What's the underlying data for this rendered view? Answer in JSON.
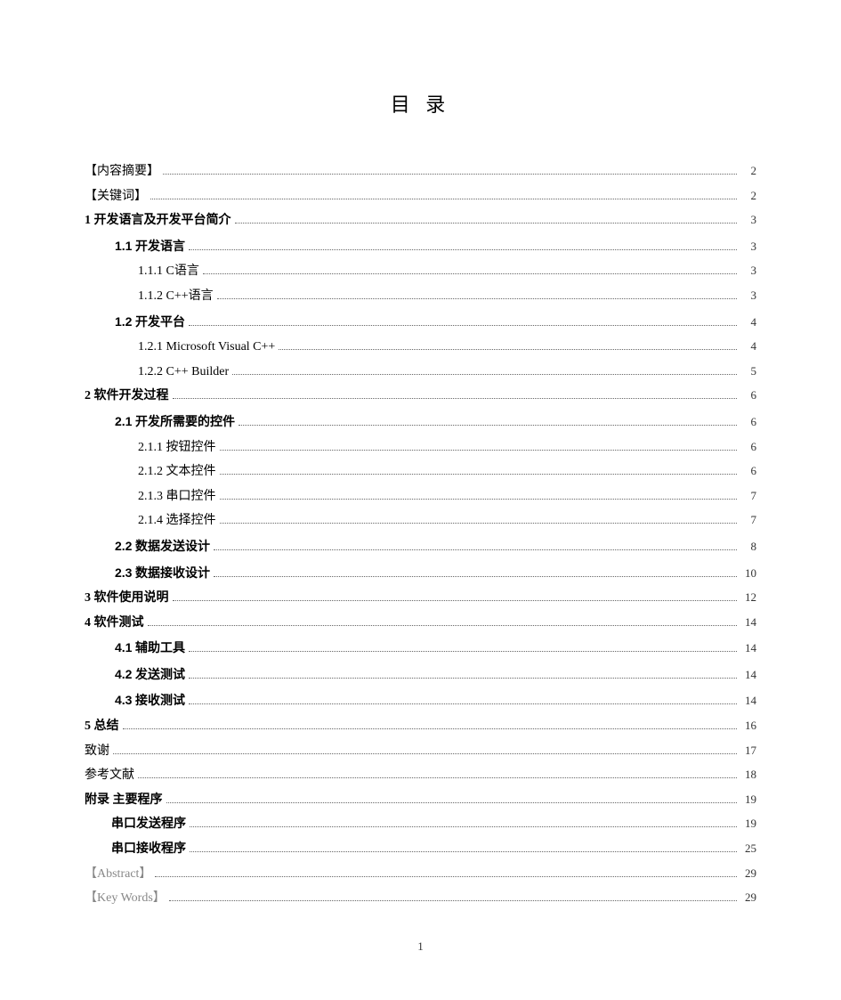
{
  "title": "目 录",
  "page_number": "1",
  "toc": [
    {
      "label": "【内容摘要】",
      "page": "2",
      "level": 0,
      "bold": false
    },
    {
      "label": "【关键词】",
      "page": "2",
      "level": 0,
      "bold": false
    },
    {
      "prefix": "1",
      "label": "开发语言及开发平台简介",
      "page": "3",
      "level": 0,
      "bold": true,
      "prefixClass": "num-serif bold"
    },
    {
      "prefix": "1.1",
      "label": "开发语言",
      "page": "3",
      "level": 1,
      "bold": true,
      "prefixClass": "num-sans"
    },
    {
      "prefix": "1.1.1",
      "label": "C语言",
      "page": "3",
      "level": 2,
      "bold": false,
      "prefixClass": "num-serif"
    },
    {
      "prefix": "1.1.2",
      "label": "C++语言",
      "page": "3",
      "level": 2,
      "bold": false,
      "prefixClass": "num-serif"
    },
    {
      "prefix": "1.2",
      "label": "开发平台",
      "page": "4",
      "level": 1,
      "bold": true,
      "prefixClass": "num-sans"
    },
    {
      "prefix": "1.2.1",
      "label": "Microsoft Visual C++",
      "page": "4",
      "level": 2,
      "bold": false,
      "prefixClass": "num-serif"
    },
    {
      "prefix": "1.2.2",
      "label": "C++ Builder",
      "page": "5",
      "level": 2,
      "bold": false,
      "prefixClass": "num-serif"
    },
    {
      "prefix": "2",
      "label": "软件开发过程",
      "page": "6",
      "level": 0,
      "bold": true,
      "prefixClass": "num-serif bold"
    },
    {
      "prefix": "2.1",
      "label": "开发所需要的控件",
      "page": "6",
      "level": 1,
      "bold": true,
      "prefixClass": "num-sans"
    },
    {
      "prefix": "2.1.1",
      "label": "按钮控件",
      "page": "6",
      "level": 2,
      "bold": false,
      "prefixClass": "num-serif"
    },
    {
      "prefix": "2.1.2",
      "label": "文本控件",
      "page": "6",
      "level": 2,
      "bold": false,
      "prefixClass": "num-serif"
    },
    {
      "prefix": "2.1.3",
      "label": "串口控件",
      "page": "7",
      "level": 2,
      "bold": false,
      "prefixClass": "num-serif"
    },
    {
      "prefix": "2.1.4",
      "label": "选择控件",
      "page": "7",
      "level": 2,
      "bold": false,
      "prefixClass": "num-serif"
    },
    {
      "prefix": "2.2",
      "label": "数据发送设计",
      "page": "8",
      "level": 1,
      "bold": true,
      "prefixClass": "num-sans"
    },
    {
      "prefix": "2.3",
      "label": "数据接收设计",
      "page": "10",
      "level": 1,
      "bold": true,
      "prefixClass": "num-sans"
    },
    {
      "prefix": "3",
      "label": "软件使用说明",
      "page": "12",
      "level": 0,
      "bold": true,
      "prefixClass": "num-serif bold"
    },
    {
      "prefix": "4",
      "label": "软件测试",
      "page": "14",
      "level": 0,
      "bold": true,
      "prefixClass": "num-serif bold"
    },
    {
      "prefix": "4.1",
      "label": "辅助工具",
      "page": "14",
      "level": 1,
      "bold": true,
      "prefixClass": "num-sans"
    },
    {
      "prefix": "4.2",
      "label": "发送测试",
      "page": "14",
      "level": 1,
      "bold": true,
      "prefixClass": "num-sans"
    },
    {
      "prefix": "4.3",
      "label": "接收测试",
      "page": "14",
      "level": 1,
      "bold": true,
      "prefixClass": "num-sans"
    },
    {
      "prefix": "5",
      "label": "总结",
      "page": "16",
      "level": 0,
      "bold": true,
      "prefixClass": "num-serif bold"
    },
    {
      "label": "致谢",
      "page": "17",
      "level": 0,
      "bold": false
    },
    {
      "label": "参考文献",
      "page": "18",
      "level": 0,
      "bold": false
    },
    {
      "label": "附录 主要程序",
      "page": "19",
      "level": 0,
      "bold": true
    },
    {
      "label": "串口发送程序",
      "page": "19",
      "level": "1b",
      "bold": true
    },
    {
      "label": "串口接收程序",
      "page": "25",
      "level": "1b",
      "bold": true
    },
    {
      "label": "【Abstract】",
      "page": "29",
      "level": 0,
      "bold": false,
      "grey": true
    },
    {
      "label": "【Key Words】",
      "page": "29",
      "level": 0,
      "bold": false,
      "grey": true
    }
  ]
}
